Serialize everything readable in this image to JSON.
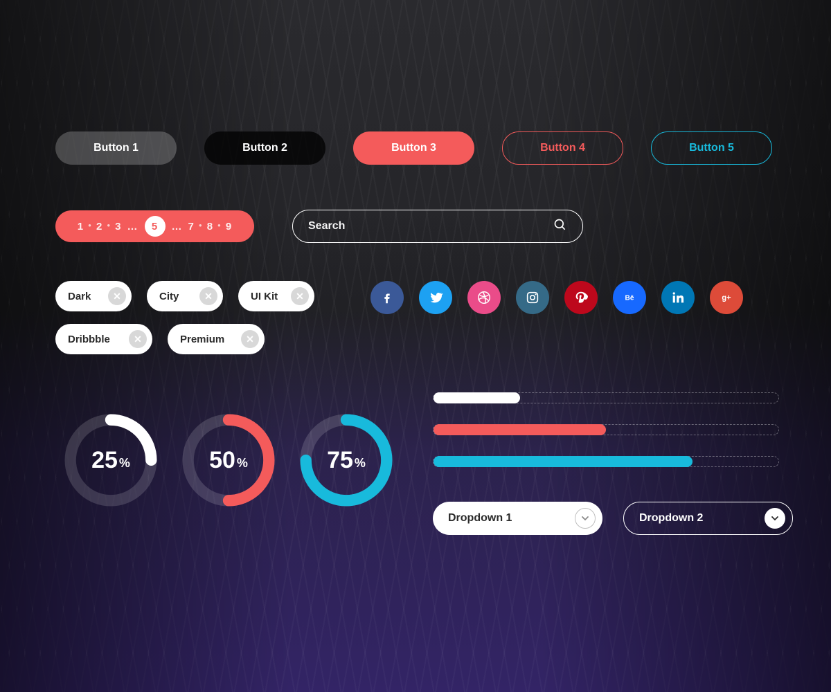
{
  "buttons": [
    "Button 1",
    "Button 2",
    "Button 3",
    "Button 4",
    "Button 5"
  ],
  "pagination": {
    "pages_left": [
      "1",
      "2",
      "3"
    ],
    "ellipsis": "…",
    "active": "5",
    "pages_right": [
      "7",
      "8",
      "9"
    ]
  },
  "search": {
    "placeholder": "Search"
  },
  "tags": [
    "Dark",
    "City",
    "UI Kit",
    "Dribbble",
    "Premium"
  ],
  "socials": [
    {
      "name": "facebook",
      "class": "fb"
    },
    {
      "name": "twitter",
      "class": "tw"
    },
    {
      "name": "dribbble",
      "class": "dr"
    },
    {
      "name": "instagram",
      "class": "ig"
    },
    {
      "name": "pinterest",
      "class": "pn"
    },
    {
      "name": "behance",
      "class": "be"
    },
    {
      "name": "linkedin",
      "class": "li"
    },
    {
      "name": "google-plus",
      "class": "gp"
    }
  ],
  "rings": [
    {
      "value": 25,
      "label": "25",
      "pct": "%",
      "color": "#ffffff"
    },
    {
      "value": 50,
      "label": "50",
      "pct": "%",
      "color": "#F45B5B"
    },
    {
      "value": 75,
      "label": "75",
      "pct": "%",
      "color": "#18BADC"
    }
  ],
  "progress": [
    {
      "value": 25,
      "color": "white"
    },
    {
      "value": 50,
      "color": "red"
    },
    {
      "value": 75,
      "color": "blue"
    }
  ],
  "dropdowns": [
    "Dropdown 1",
    "Dropdown 2"
  ],
  "colors": {
    "accent_red": "#F45B5B",
    "accent_blue": "#18BADC",
    "overlay_purple": "#332466"
  }
}
